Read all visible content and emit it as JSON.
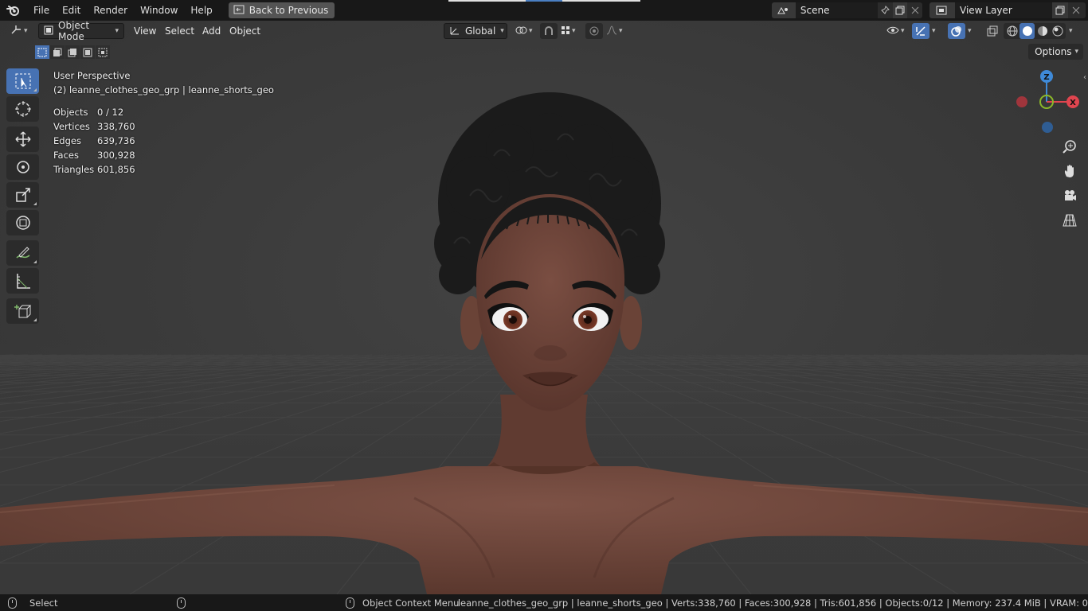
{
  "topbar": {
    "menus": [
      "File",
      "Edit",
      "Render",
      "Window",
      "Help"
    ],
    "back_button": "Back to Previous",
    "scene": "Scene",
    "view_layer": "View Layer"
  },
  "header": {
    "mode": "Object Mode",
    "menus": [
      "View",
      "Select",
      "Add",
      "Object"
    ],
    "orientation": "Global",
    "options": "Options"
  },
  "overlay": {
    "perspective": "User Perspective",
    "active_object": "(2) leanne_clothes_geo_grp | leanne_shorts_geo",
    "stats": [
      {
        "label": "Objects",
        "value": "0 / 12"
      },
      {
        "label": "Vertices",
        "value": "338,760"
      },
      {
        "label": "Edges",
        "value": "639,736"
      },
      {
        "label": "Faces",
        "value": "300,928"
      },
      {
        "label": "Triangles",
        "value": "601,856"
      }
    ]
  },
  "gizmo": {
    "z": "Z",
    "x": "X"
  },
  "statusbar": {
    "left": "Select",
    "middle": "Object Context Menu",
    "right": "leanne_clothes_geo_grp | leanne_shorts_geo | Verts:338,760 | Faces:300,928 | Tris:601,856 | Objects:0/12 | Memory: 237.4 MiB | VRAM: 0"
  },
  "colors": {
    "accent": "#4772b3",
    "axis_x": "#e0454f",
    "axis_y": "#8bb82a",
    "axis_z": "#3f8ad8"
  }
}
